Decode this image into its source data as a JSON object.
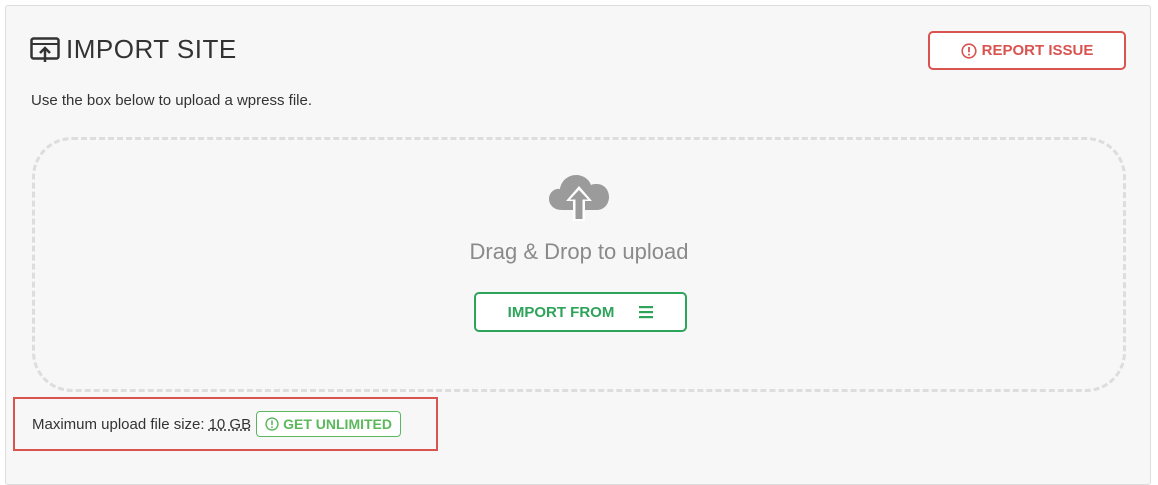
{
  "header": {
    "title": "IMPORT SITE",
    "title_icon": "import-screen-icon",
    "report_button": {
      "label": "REPORT ISSUE",
      "icon": "alert-circle-icon"
    }
  },
  "subtitle": "Use the box below to upload a wpress file.",
  "dropzone": {
    "icon": "cloud-upload-icon",
    "text": "Drag & Drop to upload",
    "import_button": {
      "label": "IMPORT FROM",
      "icon": "menu-icon"
    }
  },
  "upload_limit": {
    "label": "Maximum upload file size:",
    "size": "10 GB",
    "unlimited_button": {
      "label": "GET UNLIMITED",
      "icon": "alert-circle-icon"
    }
  },
  "colors": {
    "danger": "#d9534f",
    "success": "#2ea35a",
    "success_light": "#5cb85c",
    "panel_bg": "#f7f7f7"
  }
}
